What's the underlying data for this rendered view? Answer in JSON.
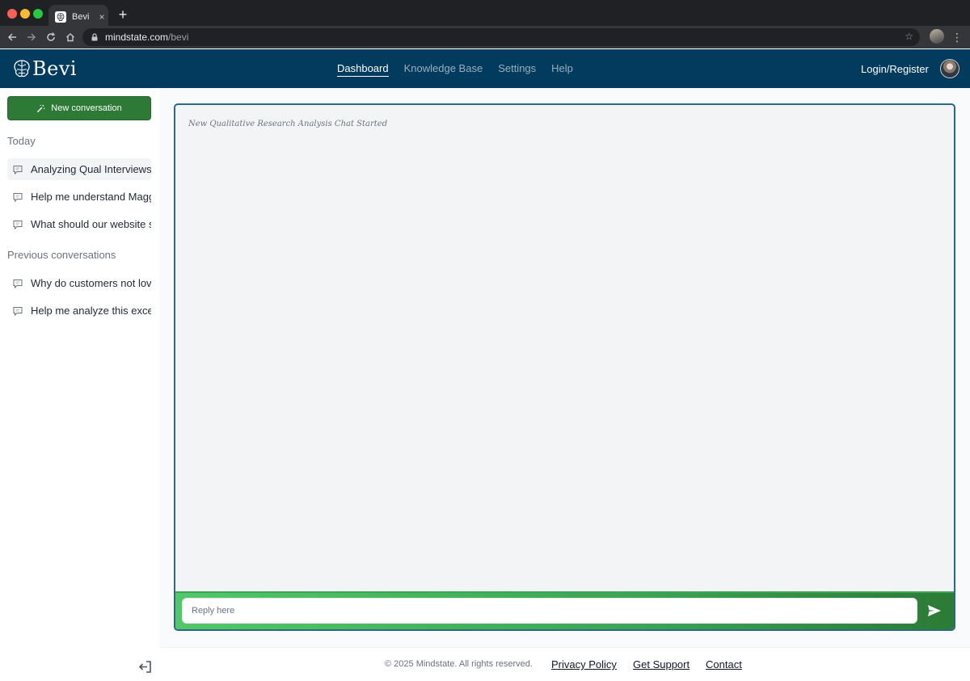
{
  "browser": {
    "tab_title": "Bevi",
    "tab_close": "×",
    "new_tab": "+",
    "url_host": "mindstate.com",
    "url_path": "/bevi",
    "menu_glyph": "⋮",
    "star_glyph": "☆"
  },
  "header": {
    "logo_text": "Bevi",
    "nav": [
      {
        "label": "Dashboard",
        "active": true
      },
      {
        "label": "Knowledge Base",
        "active": false
      },
      {
        "label": "Settings",
        "active": false
      },
      {
        "label": "Help",
        "active": false
      }
    ],
    "login_label": "Login/Register"
  },
  "sidebar": {
    "new_conversation_label": "New conversation",
    "today_label": "Today",
    "today_items": [
      {
        "label": "Analyzing Qual Interviews",
        "active": true
      },
      {
        "label": "Help me understand Maggie",
        "active": false
      },
      {
        "label": "What should our website say",
        "active": false
      }
    ],
    "previous_label": "Previous conversations",
    "previous_items": [
      {
        "label": "Why do customers not love",
        "active": false
      },
      {
        "label": "Help me analyze this excel",
        "active": false
      }
    ]
  },
  "chat": {
    "status_text": "New Qualitative Research Analysis Chat Started",
    "reply_placeholder": "Reply here",
    "reply_value": ""
  },
  "footer": {
    "copyright": "© 2025 Mindstate. All rights reserved.",
    "links": [
      "Privacy Policy",
      "Get Support",
      "Contact"
    ]
  },
  "colors": {
    "header_bg": "#023b5d",
    "new_conversation_bg": "#2c7a35",
    "chat_border": "#2a6a86",
    "reply_bar_start": "#52c768",
    "reply_bar_end": "#2c7a35"
  },
  "icons": {
    "tab_favicon": "brain-icon",
    "logo": "brain-icon",
    "new_conversation": "magic-wand-icon",
    "conversation": "chat-bubble-icon",
    "send": "send-icon",
    "logout": "logout-icon"
  }
}
